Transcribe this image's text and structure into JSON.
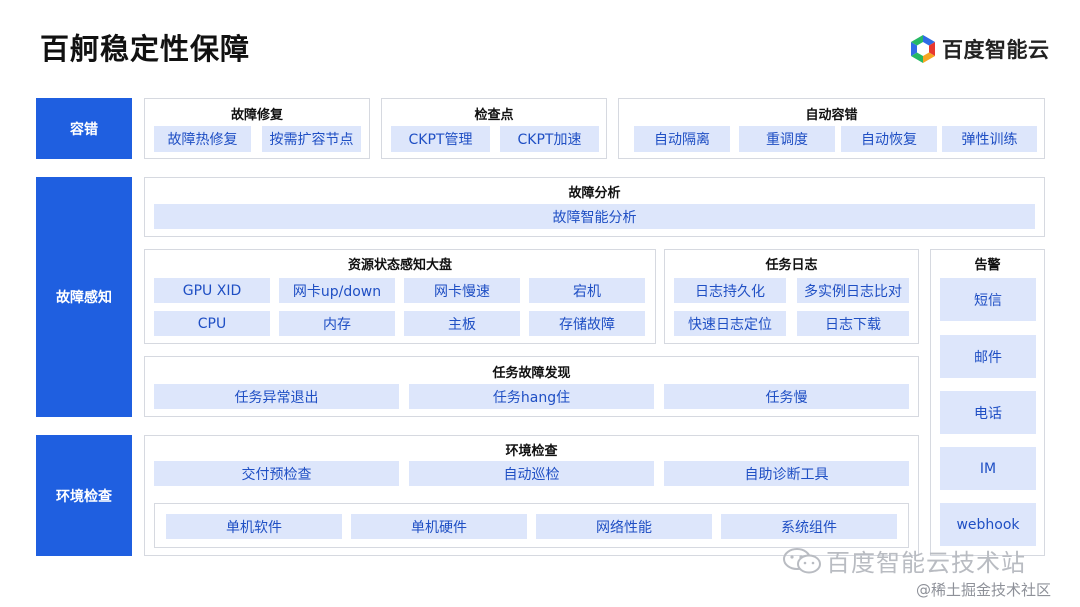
{
  "title": "百舸稳定性保障",
  "logo": {
    "text": "百度智能云",
    "icon": "baidu-cloud-logo-icon"
  },
  "sides": [
    "容错",
    "故障感知",
    "环境检查"
  ],
  "fault_tolerance": {
    "repair": {
      "title": "故障修复",
      "items": [
        "故障热修复",
        "按需扩容节点"
      ]
    },
    "checkpoint": {
      "title": "检查点",
      "items": [
        "CKPT管理",
        "CKPT加速"
      ]
    },
    "auto": {
      "title": "自动容错",
      "items": [
        "自动隔离",
        "重调度",
        "自动恢复",
        "弹性训练"
      ]
    }
  },
  "analysis": {
    "title": "故障分析",
    "item": "故障智能分析"
  },
  "resource": {
    "title": "资源状态感知大盘",
    "row1": [
      "GPU XID",
      "网卡up/down",
      "网卡慢速",
      "宕机"
    ],
    "row2": [
      "CPU",
      "内存",
      "主板",
      "存储故障"
    ]
  },
  "task_log": {
    "title": "任务日志",
    "items": [
      "日志持久化",
      "多实例日志比对",
      "快速日志定位",
      "日志下载"
    ]
  },
  "alert": {
    "title": "告警",
    "items": [
      "短信",
      "邮件",
      "电话",
      "IM",
      "webhook"
    ]
  },
  "task_fault": {
    "title": "任务故障发现",
    "items": [
      "任务异常退出",
      "任务hang住",
      "任务慢"
    ]
  },
  "env_check": {
    "title": "环境检查",
    "row1": [
      "交付预检查",
      "自动巡检",
      "自助诊断工具"
    ],
    "row2": [
      "单机软件",
      "单机硬件",
      "网络性能",
      "系统组件"
    ]
  },
  "watermark": {
    "main": "百度智能云技术站",
    "sub": "@稀土掘金技术社区",
    "icon": "wechat-icon"
  },
  "colors": {
    "side": "#1f5fe0",
    "chip_bg": "#dde6fb",
    "chip_text": "#1f4fc4",
    "border": "#d6d9e0"
  }
}
